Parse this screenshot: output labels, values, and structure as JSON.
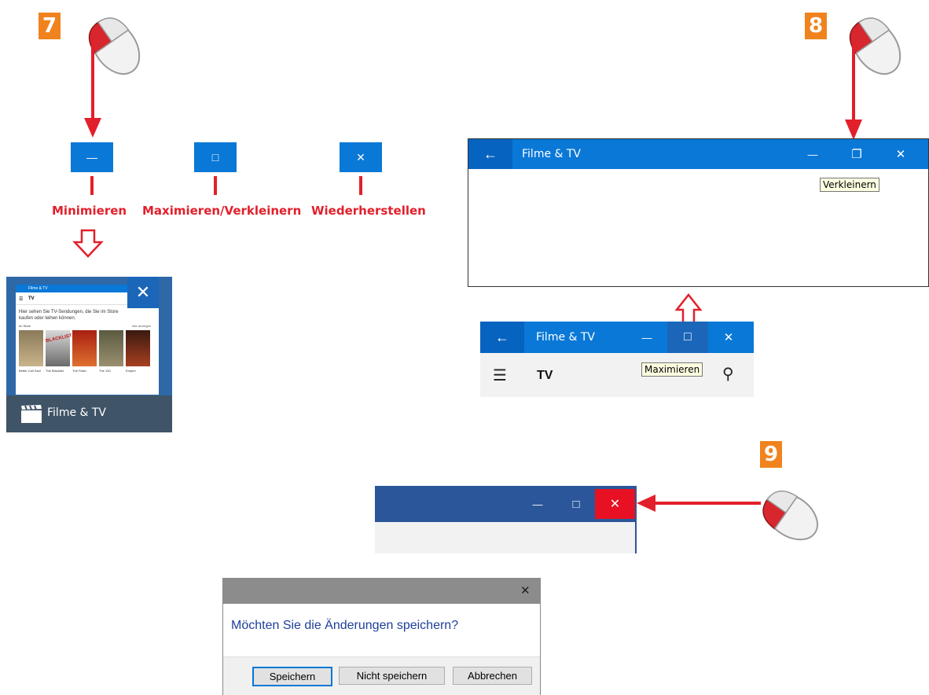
{
  "steps": {
    "s7": "7",
    "s8": "8",
    "s9": "9"
  },
  "window_buttons": {
    "minimize_symbol": "—",
    "maximize_symbol": "□",
    "close_symbol": "✕",
    "restore_symbol": "❐",
    "back_symbol": "←",
    "menu_symbol": "☰",
    "search_symbol": "⚲"
  },
  "labels": {
    "minimize": "Minimieren",
    "maximize": "Maximieren/Verkleinern",
    "close": "Wiederherstellen"
  },
  "taskbar_preview": {
    "app_name": "Filme & TV",
    "mini_title": "Filme & TV",
    "mini_heading": "TV",
    "mini_text": "Hier sehen Sie TV-Sendungen, die Sie im Store kaufen oder leihen können.",
    "mini_sub": "Im Store",
    "mini_link": "Alle anzeigen",
    "thumbs": [
      "Better Call Saul",
      "The Blacklist",
      "The Flash",
      "The 100",
      "Empire"
    ],
    "blacklist_text": "BLACKLIST"
  },
  "window8": {
    "title": "Filme & TV",
    "tooltip": "Verkleinern"
  },
  "window8b": {
    "title": "Filme & TV",
    "heading": "TV",
    "tooltip": "Maximieren"
  },
  "dialog": {
    "message": "Möchten Sie die Änderungen speichern?",
    "save": "Speichern",
    "dont_save": "Nicht speichern",
    "cancel": "Abbrechen"
  },
  "colors": {
    "accent": "#0a78d7",
    "red": "#e2202b",
    "step": "#f0831e",
    "word_blue": "#2b579a"
  }
}
